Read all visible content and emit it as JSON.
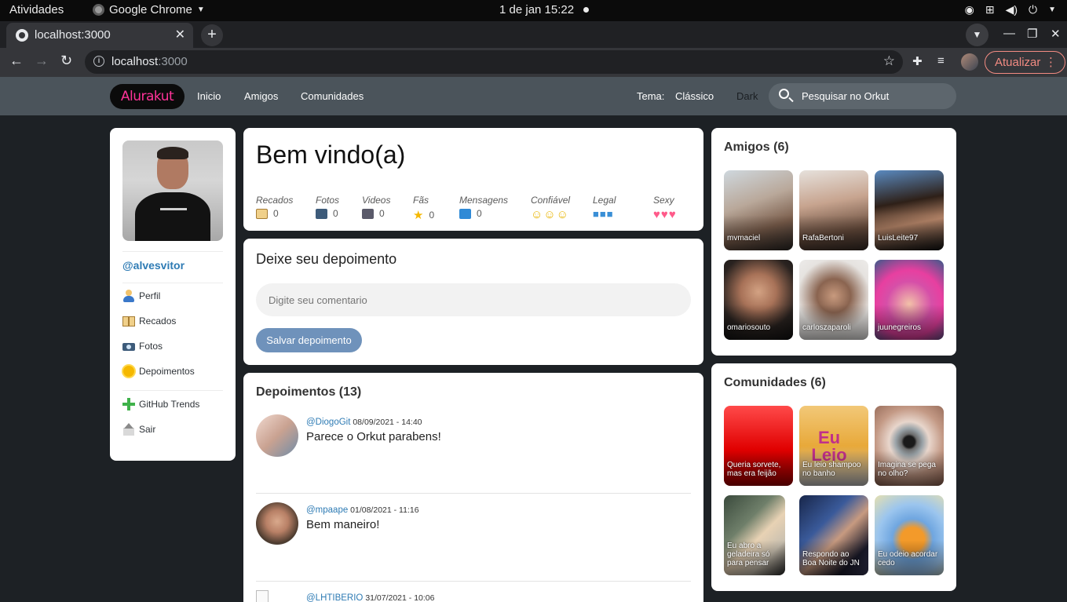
{
  "system_bar": {
    "activities": "Atividades",
    "app_name": "Google Chrome",
    "clock": "1 de jan  15:22"
  },
  "browser": {
    "tab_title": "localhost:3000",
    "url_host": "localhost",
    "url_port": ":3000",
    "update_button": "Atualizar"
  },
  "header": {
    "logo": "Alurakut",
    "nav": [
      "Inicio",
      "Amigos",
      "Comunidades"
    ],
    "theme_label": "Tema:",
    "theme_options": [
      "Clássico",
      "Dark"
    ],
    "search_placeholder": "Pesquisar no Orkut"
  },
  "sidebar": {
    "username": "@alvesvitor",
    "menu": [
      {
        "label": "Perfil",
        "icon": "user-icon"
      },
      {
        "label": "Recados",
        "icon": "book-icon"
      },
      {
        "label": "Fotos",
        "icon": "camera-icon"
      },
      {
        "label": "Depoimentos",
        "icon": "sun-icon"
      }
    ],
    "menu2": [
      {
        "label": "GitHub Trends",
        "icon": "plus-icon"
      },
      {
        "label": "Sair",
        "icon": "logout-icon"
      }
    ]
  },
  "welcome": {
    "title": "Bem vindo(a)",
    "stats": [
      {
        "label": "Recados",
        "value": "0",
        "icon": "book-icon"
      },
      {
        "label": "Fotos",
        "value": "0",
        "icon": "camera-icon"
      },
      {
        "label": "Videos",
        "value": "0",
        "icon": "video-icon"
      },
      {
        "label": "Fãs",
        "value": "0",
        "icon": "star-icon"
      },
      {
        "label": "Mensagens",
        "value": "0",
        "icon": "mail-icon"
      }
    ],
    "ratings": [
      {
        "label": "Confiável",
        "glyph": "☺☺☺",
        "color": "#e8b400"
      },
      {
        "label": "Legal",
        "glyph": "■■■",
        "color": "#3a8fd6"
      },
      {
        "label": "Sexy",
        "glyph": "♥♥♥",
        "color": "#ff5a8a"
      }
    ]
  },
  "depoimento_form": {
    "title": "Deixe seu depoimento",
    "placeholder": "Digite seu comentario",
    "button": "Salvar depoimento"
  },
  "depoimentos": {
    "title": "Depoimentos (13)",
    "items": [
      {
        "user": "@DiogoGit",
        "date": "08/09/2021 - 14:40",
        "text": "Parece o Orkut parabens!"
      },
      {
        "user": "@mpaape",
        "date": "01/08/2021 - 11:16",
        "text": "Bem maneiro!"
      },
      {
        "user": "@LHTIBERIO",
        "date": "31/07/2021 - 10:06",
        "text": ""
      }
    ]
  },
  "friends": {
    "title": "Amigos (6)",
    "items": [
      "mvmaciel",
      "RafaBertoni",
      "LuisLeite97",
      "omariosouto",
      "carloszaparoli",
      "juunegreiros"
    ]
  },
  "communities": {
    "title": "Comunidades (6)",
    "items": [
      "Queria sorvete, mas era feijão",
      "Eu leio shampoo no banho",
      "Imagina se pega no olho?",
      "Eu abro a geladeira só para pensar",
      "Respondo ao Boa Noite do JN",
      "Eu odeio acordar cedo"
    ],
    "shampoo_art": "Eu Leio"
  },
  "colors": {
    "accent_blue": "#2e7bb4",
    "logo_pink": "#ff3399",
    "header_bg": "#4b545b",
    "page_bg": "#1d2125"
  }
}
